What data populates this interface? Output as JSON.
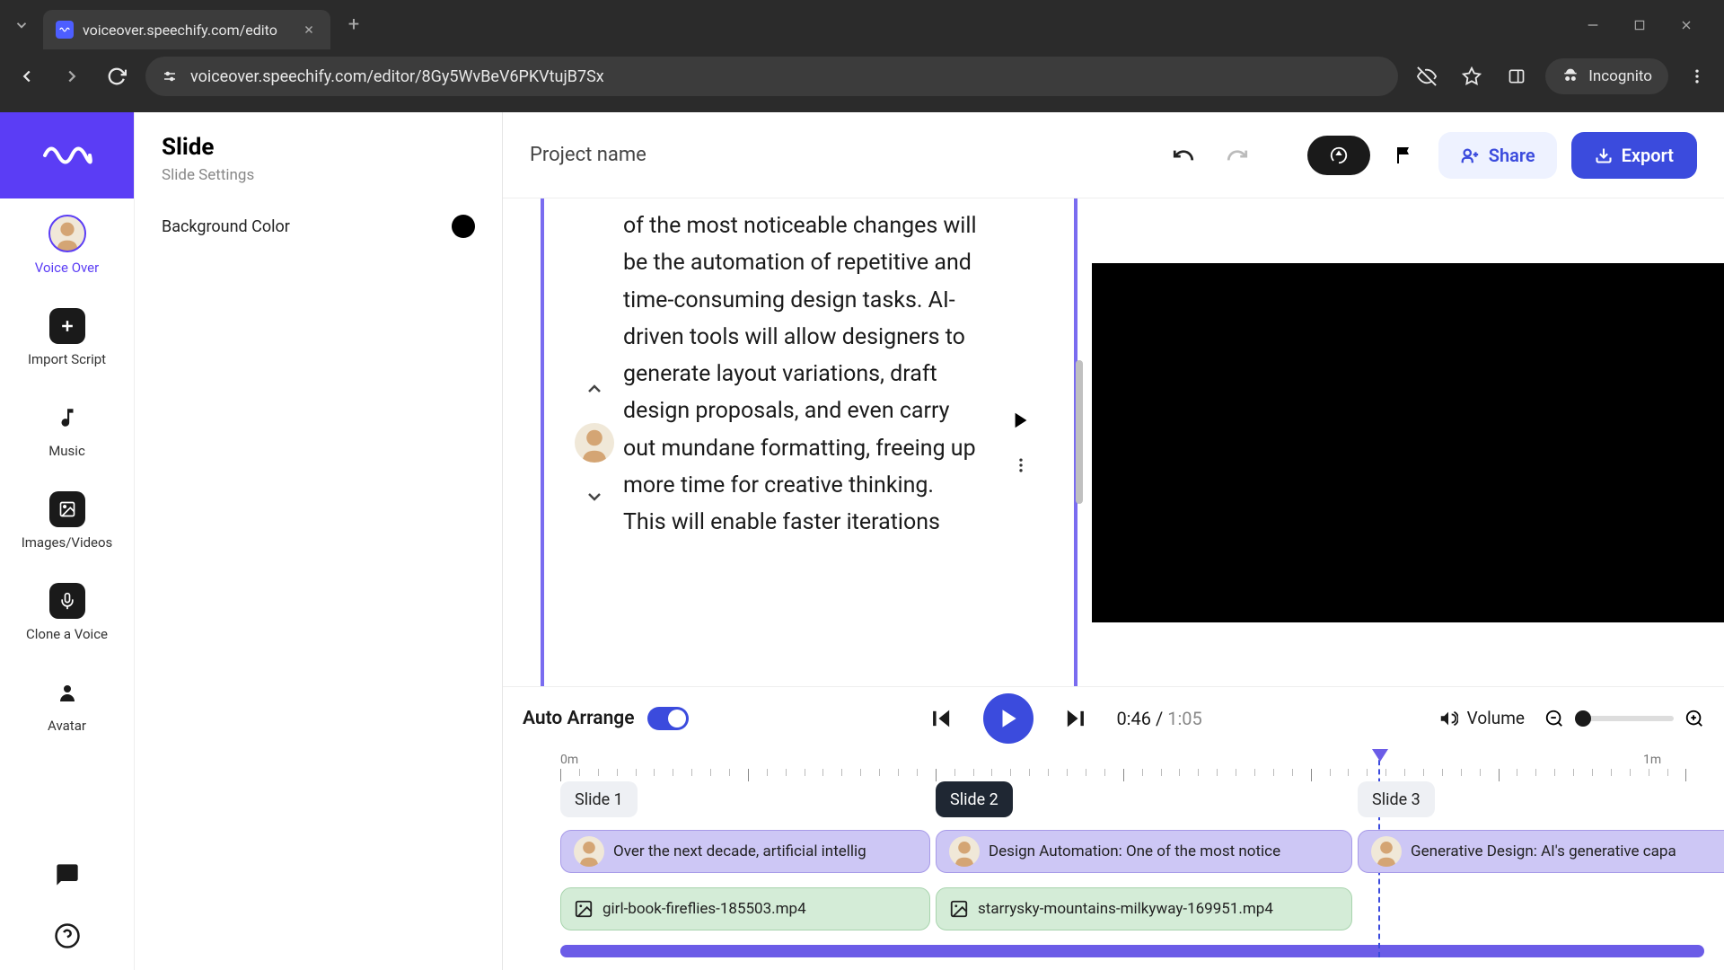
{
  "browser": {
    "tab_title": "voiceover.speechify.com/edito",
    "url": "voiceover.speechify.com/editor/8Gy5WvBeV6PKVtujB7Sx",
    "incognito": "Incognito"
  },
  "rail": {
    "voice_over": "Voice Over",
    "import_script": "Import Script",
    "music": "Music",
    "images_videos": "Images/Videos",
    "clone_voice": "Clone a Voice",
    "avatar": "Avatar"
  },
  "settings": {
    "title": "Slide",
    "subtitle": "Slide Settings",
    "bg_color_label": "Background Color",
    "bg_color": "#000000"
  },
  "topbar": {
    "project_name": "Project name",
    "share": "Share",
    "export": "Export"
  },
  "script": {
    "text": "of the most noticeable changes will be the automation of repetitive and time-consuming design tasks. AI-driven tools will allow designers to generate layout variations, draft design proposals, and even carry out mundane formatting, freeing up more time for creative thinking. This will enable faster iterations"
  },
  "playback": {
    "auto_arrange": "Auto Arrange",
    "current": "0:46",
    "total": "1:05",
    "volume": "Volume"
  },
  "timeline": {
    "label_0": "0m",
    "label_1": "1m",
    "slides": [
      "Slide 1",
      "Slide 2",
      "Slide 3"
    ],
    "voice_clips": [
      "Over the next decade, artificial intellig",
      "Design Automation: One of the most notice",
      "Generative Design: AI's generative capa"
    ],
    "media_clips": [
      "girl-book-fireflies-185503.mp4",
      "starrysky-mountains-milkyway-169951.mp4"
    ]
  }
}
